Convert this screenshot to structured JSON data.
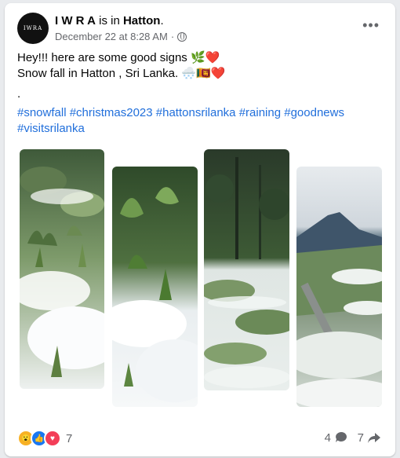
{
  "post": {
    "avatar_text": "IWRA",
    "author": "I W R A",
    "is_in": "is in",
    "place": "Hatton",
    "period": ".",
    "timestamp": "December 22 at 8:28 AM",
    "separator": "·",
    "more": "•••",
    "line1": "Hey!!! here are some good signs 🌿❤️",
    "line2": "Snow fall in Hatton , Sri Lanka. 🌨️🇱🇰❤️",
    "line3": ".",
    "hashtags": [
      "#snowfall",
      "#christmas2023",
      "#hattonsrilanka",
      "#raining",
      "#goodnews",
      "#visitsrilanka"
    ]
  },
  "footer": {
    "reaction_count": "7",
    "comment_count": "4",
    "share_count": "7"
  },
  "colors": {
    "link": "#216fdb",
    "like": "#1877f2",
    "love": "#f33e58",
    "wow": "#f7b125"
  }
}
